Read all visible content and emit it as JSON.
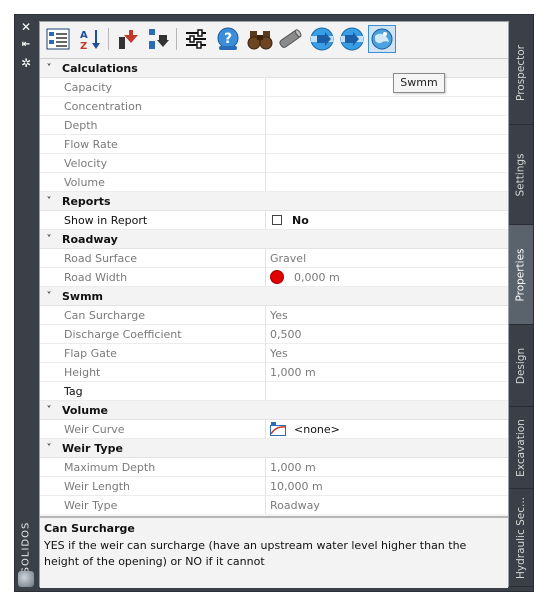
{
  "window": {
    "title": "SOLIDOS",
    "tooltip": "Swmm"
  },
  "toolbar": {
    "buttons": [
      {
        "icon": "categorized-view-icon"
      },
      {
        "icon": "sort-alphabetical-icon"
      },
      {
        "icon": "move-up-icon"
      },
      {
        "icon": "move-down-icon"
      },
      {
        "icon": "settings-sliders-icon"
      },
      {
        "icon": "help-icon"
      },
      {
        "icon": "find-binoculars-icon"
      },
      {
        "icon": "pipe-icon"
      },
      {
        "icon": "flow-forward-icon"
      },
      {
        "icon": "flow-back-icon"
      },
      {
        "icon": "swmm-globe-icon"
      }
    ]
  },
  "categories": [
    {
      "label": "Calculations",
      "rows": [
        {
          "name": "Capacity",
          "value": ""
        },
        {
          "name": "Concentration",
          "value": ""
        },
        {
          "name": "Depth",
          "value": ""
        },
        {
          "name": "Flow Rate",
          "value": ""
        },
        {
          "name": "Velocity",
          "value": ""
        },
        {
          "name": "Volume",
          "value": ""
        }
      ]
    },
    {
      "label": "Reports",
      "rows": [
        {
          "name": "Show in Report",
          "value": "No"
        }
      ]
    },
    {
      "label": "Roadway",
      "rows": [
        {
          "name": "Road Surface",
          "value": "Gravel"
        },
        {
          "name": "Road Width",
          "value": "0,000 m"
        }
      ]
    },
    {
      "label": "Swmm",
      "rows": [
        {
          "name": "Can Surcharge",
          "value": "Yes"
        },
        {
          "name": "Discharge Coefficient",
          "value": "0,500"
        },
        {
          "name": "Flap Gate",
          "value": "Yes"
        },
        {
          "name": "Height",
          "value": "1,000 m"
        },
        {
          "name": "Tag",
          "value": ""
        }
      ]
    },
    {
      "label": "Volume",
      "rows": [
        {
          "name": "Weir Curve",
          "value": "<none>"
        }
      ]
    },
    {
      "label": "Weir Type",
      "rows": [
        {
          "name": "Maximum Depth",
          "value": "1,000 m"
        },
        {
          "name": "Weir Length",
          "value": "10,000 m"
        },
        {
          "name": "Weir Type",
          "value": "Roadway"
        }
      ]
    }
  ],
  "description": {
    "title": "Can Surcharge",
    "text": "YES if the weir can surcharge (have an upstream water level higher than the height of the opening) or NO if it cannot"
  },
  "tabs": [
    "Prospector",
    "Settings",
    "Properties",
    "Design",
    "Excavation",
    "Hydraulic Sec..."
  ],
  "active_tab": "Properties"
}
